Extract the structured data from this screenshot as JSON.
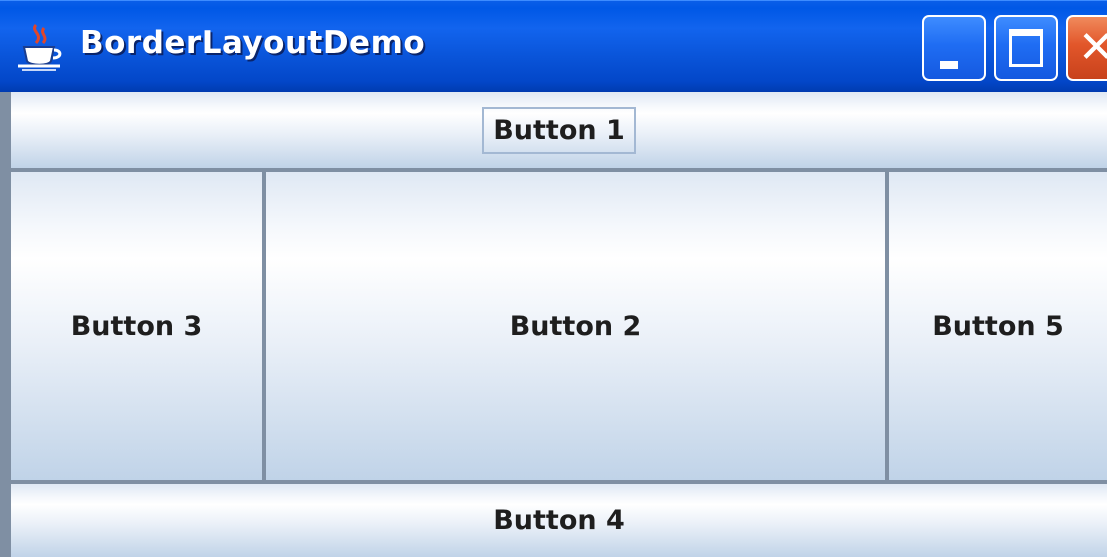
{
  "window": {
    "title": "BorderLayoutDemo",
    "icon": "java-coffee-cup-icon",
    "controls": {
      "minimize": "minimize-icon",
      "maximize": "maximize-icon",
      "close": "close-icon",
      "close_glyph": "✕"
    },
    "colors": {
      "titlebar": "#0058e6",
      "close_button": "#e2562a",
      "separator": "#7f8fa3"
    }
  },
  "buttons": {
    "north": "Button 1",
    "center": "Button 2",
    "west": "Button 3",
    "south": "Button 4",
    "east": "Button 5"
  }
}
